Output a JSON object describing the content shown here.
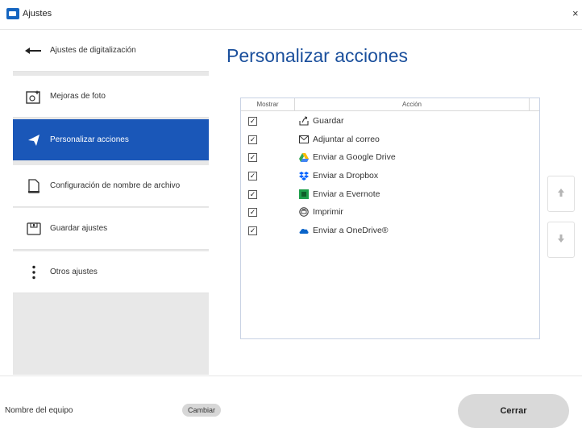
{
  "window": {
    "title": "Ajustes",
    "close_glyph": "×"
  },
  "sidebar": {
    "items": [
      {
        "label": "Ajustes de digitalización",
        "icon": "scan-arrow-icon",
        "active": false
      },
      {
        "label": "Mejoras de foto",
        "icon": "photo-enhance-icon",
        "active": false
      },
      {
        "label": "Personalizar acciones",
        "icon": "send-icon",
        "active": true
      },
      {
        "label": "Configuración de nombre de archivo",
        "icon": "document-icon",
        "active": false
      },
      {
        "label": "Guardar ajustes",
        "icon": "save-settings-icon",
        "active": false
      },
      {
        "label": "Otros ajustes",
        "icon": "vertical-dots-icon",
        "active": false
      }
    ]
  },
  "main": {
    "title": "Personalizar acciones",
    "table": {
      "columns": [
        "Mostrar",
        "Acción"
      ],
      "rows": [
        {
          "checked": true,
          "label": "Guardar",
          "icon": "save-icon"
        },
        {
          "checked": true,
          "label": "Adjuntar al correo",
          "icon": "mail-icon"
        },
        {
          "checked": true,
          "label": "Enviar a Google Drive",
          "icon": "google-drive-icon"
        },
        {
          "checked": true,
          "label": "Enviar a Dropbox",
          "icon": "dropbox-icon"
        },
        {
          "checked": true,
          "label": "Enviar a Evernote",
          "icon": "evernote-icon"
        },
        {
          "checked": true,
          "label": "Imprimir",
          "icon": "print-icon"
        },
        {
          "checked": true,
          "label": "Enviar a OneDrive®",
          "icon": "onedrive-icon"
        }
      ]
    },
    "move_up_glyph": "▲",
    "move_down_glyph": "▼"
  },
  "footer": {
    "device_label": "Nombre del equipo",
    "change_button": "Cambiar",
    "close_button": "Cerrar"
  },
  "colors": {
    "accent": "#1a57b8",
    "title": "#1a4f9c"
  }
}
